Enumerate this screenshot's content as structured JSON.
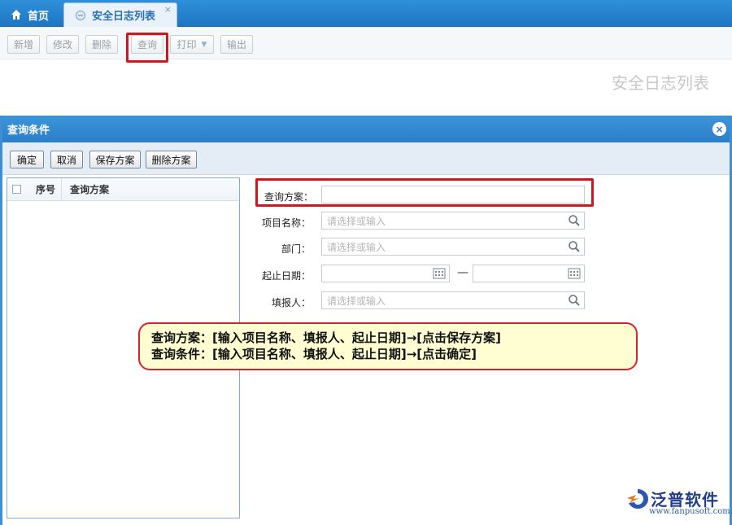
{
  "tabs": {
    "home_label": "首页",
    "active_label": "安全日志列表",
    "close_glyph": "×"
  },
  "toolbar": {
    "buttons": [
      "新增",
      "修改",
      "删除",
      "查询",
      "打印",
      "输出"
    ],
    "highlighted": "查询"
  },
  "page_heading": "安全日志列表",
  "dialog": {
    "title": "查询条件",
    "close_glyph": "×",
    "buttons": [
      "确定",
      "取消",
      "保存方案",
      "删除方案"
    ],
    "list": {
      "col_seq": "序号",
      "col_plan": "查询方案"
    },
    "form": {
      "plan_label": "查询方案：",
      "plan_value": "",
      "project_label": "项目名称：",
      "project_placeholder": "请选择或输入",
      "dept_label": "部门：",
      "dept_placeholder": "请选择或输入",
      "date_label": "起止日期：",
      "date_separator": "—",
      "reporter_label": "填报人：",
      "reporter_placeholder": "请选择或输入"
    }
  },
  "callout": {
    "line1": "查询方案：[输入项目名称、填报人、起止日期]→[点击保存方案]",
    "line2": "查询条件：[输入项目名称、填报人、起止日期]→[点击确定]"
  },
  "logo": {
    "name": "泛普软件",
    "url": "www.fanpusoft.com"
  },
  "colors": {
    "tabbar_blue": "#1f76c2",
    "highlight_red": "#d0171d",
    "callout_bg": "#fefed2",
    "logo_blue": "#223d8a"
  }
}
